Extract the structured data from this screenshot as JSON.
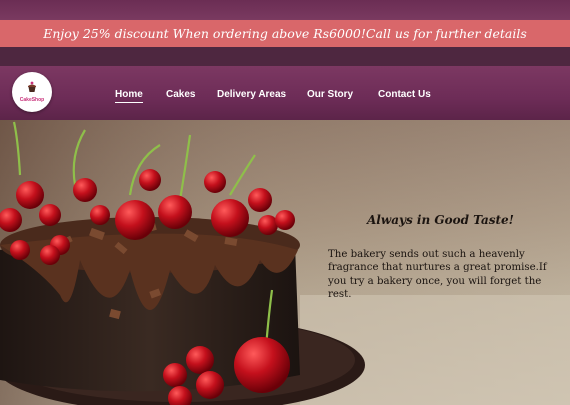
{
  "promo": {
    "text": "Enjoy 25% discount When ordering above Rs6000!Call us for further details"
  },
  "logo": {
    "text": "CakeShop",
    "icon": "cake-icon"
  },
  "nav": {
    "items": [
      {
        "label": "Home",
        "active": true
      },
      {
        "label": "Cakes",
        "active": false
      },
      {
        "label": "Delivery Areas",
        "active": false
      },
      {
        "label": "Our Story",
        "active": false
      },
      {
        "label": "Contact Us",
        "active": false
      }
    ]
  },
  "hero": {
    "tagline": "Always in Good Taste!",
    "description": "The bakery sends out such a heavenly fragrance that nurtures a great promise.If you try a bakery once, you will forget the rest."
  },
  "colors": {
    "promo_bg": "#d9676a",
    "nav_bg": "#6d2c57",
    "accent": "#c8317a"
  }
}
